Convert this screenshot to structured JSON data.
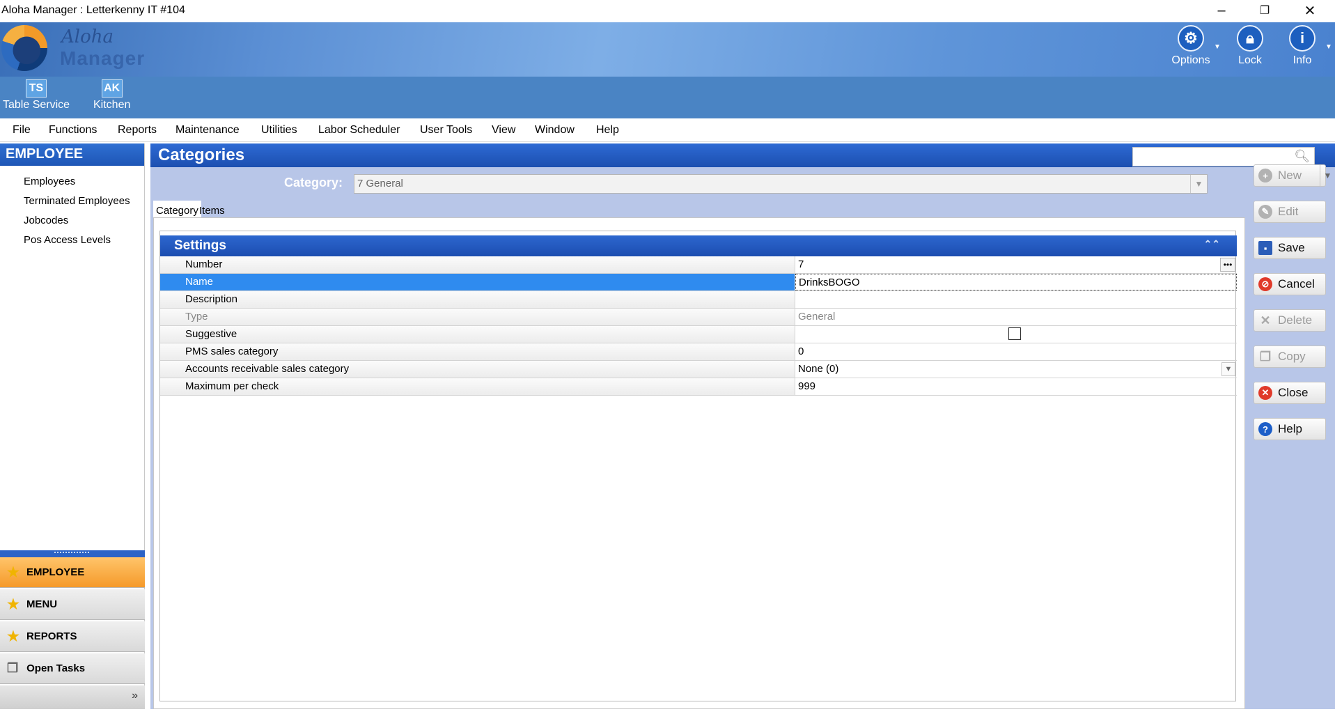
{
  "window": {
    "title": "Aloha Manager : Letterkenny IT #104",
    "controls": [
      "–",
      "❐",
      "✕"
    ]
  },
  "header": {
    "logo_script": "Aloha",
    "logo_word": "Manager",
    "buttons": [
      {
        "label": "Options",
        "icon": "gear-icon"
      },
      {
        "label": "Lock",
        "icon": "lock-icon"
      },
      {
        "label": "Info",
        "icon": "info-icon"
      }
    ]
  },
  "quickbar": [
    {
      "badge": "TS",
      "label": "Table Service"
    },
    {
      "badge": "AK",
      "label": "Kitchen"
    }
  ],
  "menu": [
    "File",
    "Functions",
    "Reports",
    "Maintenance",
    "Utilities",
    "Labor Scheduler",
    "User Tools",
    "View",
    "Window",
    "Help"
  ],
  "sidebar": {
    "heading": "EMPLOYEE",
    "items": [
      "Employees",
      "Terminated Employees",
      "Jobcodes",
      "Pos Access Levels"
    ],
    "nav": [
      {
        "label": "EMPLOYEE",
        "icon": "star-icon",
        "active": true
      },
      {
        "label": "MENU",
        "icon": "star-icon"
      },
      {
        "label": "REPORTS",
        "icon": "star-icon"
      },
      {
        "label": "Open Tasks",
        "icon": "tasks-icon"
      }
    ],
    "footer_chevron": "»"
  },
  "main": {
    "title": "Categories",
    "category_label": "Category:",
    "category_value": "7 General",
    "tabs": [
      "Category",
      "Items"
    ],
    "settings": {
      "heading": "Settings",
      "rows": [
        {
          "key": "Number",
          "value": "7"
        },
        {
          "key": "Name",
          "value": "DrinksBOGO"
        },
        {
          "key": "Description",
          "value": ""
        },
        {
          "key": "Type",
          "value": "General"
        },
        {
          "key": "Suggestive",
          "value": ""
        },
        {
          "key": "PMS sales category",
          "value": "0"
        },
        {
          "key": "Accounts receivable sales category",
          "value": "None (0)"
        },
        {
          "key": "Maximum per check",
          "value": "999"
        }
      ]
    },
    "actions": [
      "New",
      "Edit",
      "Save",
      "Cancel",
      "Delete",
      "Copy",
      "Close",
      "Help"
    ]
  },
  "colors": {
    "header_blue": "#1c4fb0",
    "selected_row": "#2f8bef",
    "active_nav": "#f59a2a"
  }
}
